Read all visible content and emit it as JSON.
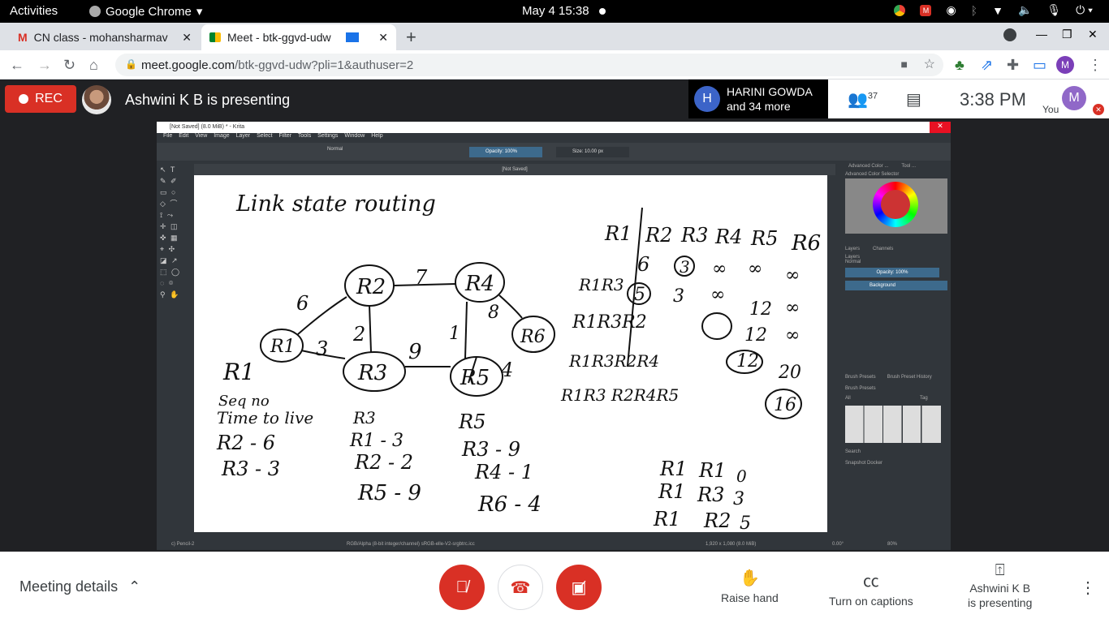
{
  "system_bar": {
    "activities": "Activities",
    "app_name": "Google Chrome",
    "clock": "May 4  15:38"
  },
  "tabs": [
    {
      "title": "CN class - mohansharmav",
      "favicon": "gmail-icon"
    },
    {
      "title": "Meet - btk-ggvd-udw",
      "favicon": "meet-icon"
    }
  ],
  "address_bar": {
    "domain": "meet.google.com",
    "path": "/btk-ggvd-udw?pli=1&authuser=2"
  },
  "profile_initial": "M",
  "meet_header": {
    "rec_label": "REC",
    "presenting_text": "Ashwini K B is presenting",
    "participant_initial": "H",
    "participant_name": "HARINI GOWDA",
    "participant_more": "and 34 more",
    "people_count": "37",
    "time": "3:38  PM",
    "you_label": "You",
    "self_initial": "M"
  },
  "krita": {
    "title": "[Not Saved]  (8.0 MiB)  * - Krita",
    "menu": "File Edit View Image Layer Select Filter Tools Settings Window Help",
    "blend_mode": "Normal",
    "opacity": "Opacity: 100%",
    "size": "Size: 10.00 px",
    "doc_tab": "[Not Saved]",
    "dock_color_tab": "Advanced Color ...",
    "dock_tool_tab": "Tool ...",
    "color_selector_label": "Advanced Color Selector",
    "layers_tab": "Layers",
    "channels_tab": "Channels",
    "layers_label": "Layers",
    "layer_blend": "Normal",
    "layer_opacity": "Opacity:  100%",
    "layer_name": "Background",
    "brush_presets_tab": "Brush Presets",
    "brush_history_tab": "Brush Preset History",
    "brush_presets_label": "Brush Presets",
    "brush_filter": "All",
    "brush_tag": "Tag",
    "search_label": "Search",
    "snapshot_label": "Snapshot Docker",
    "status_brush": "c) Pencil-2",
    "status_color": "RGB/Alpha (8-bit integer/channel)  sRGB-elle-V2-srgbtrc.icc",
    "status_dims": "1,920 x 1,080 (8.0 MiB)",
    "status_angle": "0.00°",
    "status_zoom": "80%"
  },
  "drawing": {
    "title": "Link state routing",
    "nodes": [
      "R1",
      "R2",
      "R3",
      "R4",
      "R5",
      "R6"
    ],
    "edges": [
      {
        "from": "R1",
        "to": "R2",
        "cost": "6"
      },
      {
        "from": "R1",
        "to": "R3",
        "cost": "3"
      },
      {
        "from": "R2",
        "to": "R3",
        "cost": "2"
      },
      {
        "from": "R2",
        "to": "R4",
        "cost": "7"
      },
      {
        "from": "R3",
        "to": "R5",
        "cost": "9"
      },
      {
        "from": "R4",
        "to": "R5",
        "cost": "1"
      },
      {
        "from": "R4",
        "to": "R6",
        "cost": "8"
      },
      {
        "from": "R5",
        "to": "R6",
        "cost": "4"
      }
    ],
    "notes_r1": [
      "R1",
      "Seq no",
      "Time to live",
      "R2 - 6",
      "R3 - 3"
    ],
    "notes_r3": [
      "R3",
      "R1 - 3",
      "R2 - 2",
      "R5 - 9"
    ],
    "notes_r5": [
      "R5",
      "R3 - 9",
      "R4 - 1",
      "R6 - 4"
    ],
    "table_header": [
      "R1",
      "R2",
      "R3",
      "R4",
      "R5",
      "R6"
    ],
    "table_rows": [
      {
        "label": "",
        "values": [
          "6",
          "3",
          "∞",
          "∞",
          "∞"
        ]
      },
      {
        "label": "R1R3",
        "values": [
          "5",
          "3",
          "∞",
          "12",
          "∞"
        ]
      },
      {
        "label": "R1R3R2",
        "values": [
          "",
          "",
          "",
          "12",
          "∞"
        ]
      },
      {
        "label": "R1R3R2R4",
        "values": [
          "",
          "",
          "",
          "12",
          "20"
        ]
      },
      {
        "label": "R1R3 R2R4R5",
        "values": [
          "",
          "",
          "",
          "",
          "16"
        ]
      }
    ],
    "bottom_table": [
      [
        "R1",
        "R1",
        "0"
      ],
      [
        "R1",
        "R3",
        "3"
      ],
      [
        "R1",
        "R2",
        "5"
      ]
    ]
  },
  "bottom_bar": {
    "meeting_details": "Meeting details",
    "raise_hand": "Raise hand",
    "captions": "Turn on captions",
    "presenter_line1": "Ashwini K B",
    "presenter_line2": "is presenting"
  },
  "colors": {
    "red": "#d93025",
    "meet_bg": "#202124",
    "krita_bg": "#31363b",
    "accent_blue": "#3d6a8c"
  }
}
